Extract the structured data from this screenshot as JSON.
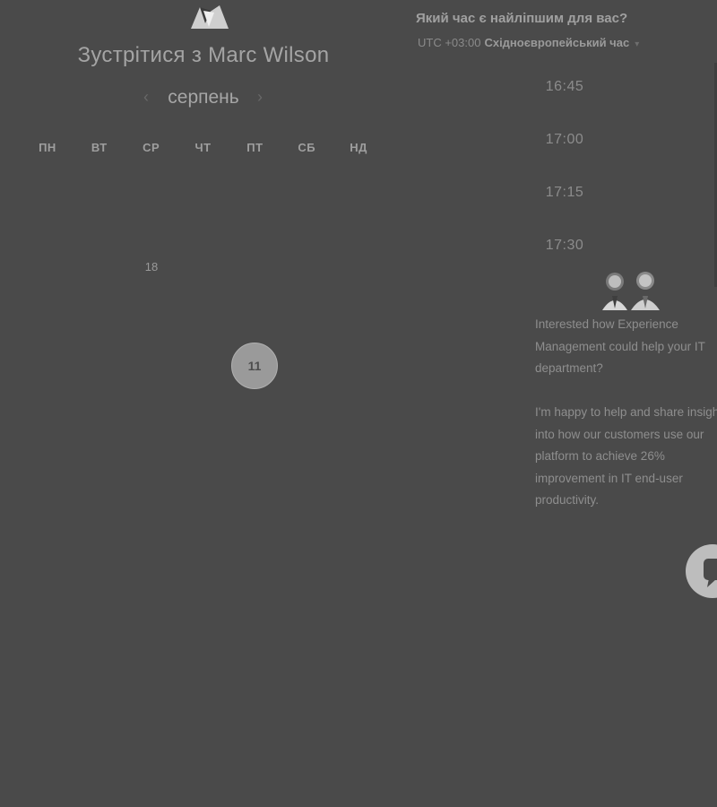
{
  "header": {
    "title": "Зустрітися з Marc Wilson"
  },
  "calendar": {
    "month": "серпень",
    "prev_icon": "chevron-left-icon",
    "next_icon": "chevron-right-icon",
    "weekdays": [
      "ПН",
      "ВТ",
      "СР",
      "ЧТ",
      "ПТ",
      "СБ",
      "НД"
    ],
    "visible_day": "18",
    "selected_day": "11"
  },
  "timezone": {
    "question": "Який час є найліпшим для вас?",
    "offset": "UTC +03:00",
    "name": "Східноєвропейський час"
  },
  "time_slots": [
    "16:45",
    "17:00",
    "17:15",
    "17:30"
  ],
  "promo": {
    "paragraph1": "Interested how Experience Management could help your IT department?",
    "paragraph2": "I'm happy to help and share insight into how our customers use our platform to achieve 26% improvement in IT end-user productivity."
  },
  "colors": {
    "background": "#4a4a4a",
    "selected_day_bg": "#9a9a9a",
    "chat_button_bg": "#bdbdbd"
  }
}
